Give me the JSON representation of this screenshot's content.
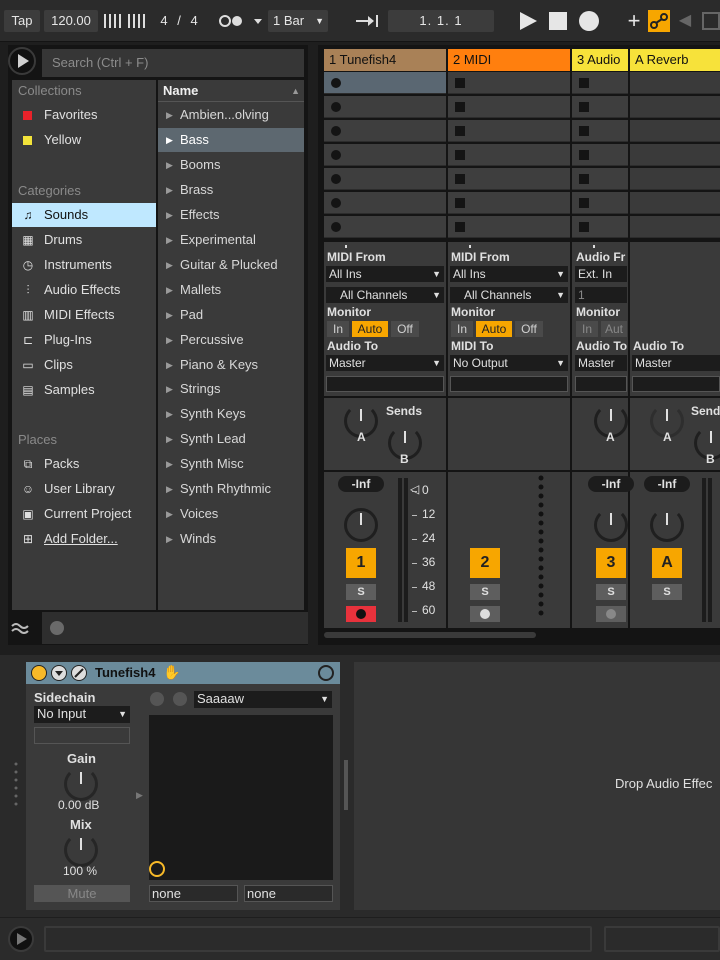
{
  "transport": {
    "tap": "Tap",
    "tempo": "120.00",
    "signature_num": "4",
    "signature_sep": "/",
    "signature_den": "4",
    "quantize": "1 Bar",
    "position": "1.   1.   1"
  },
  "browser": {
    "search_placeholder": "Search (Ctrl + F)",
    "collections_title": "Collections",
    "collections": [
      {
        "label": "Favorites",
        "color": "#e8222a"
      },
      {
        "label": "Yellow",
        "color": "#f2e33a"
      }
    ],
    "categories_title": "Categories",
    "categories": [
      {
        "label": "Sounds",
        "icon": "note-icon"
      },
      {
        "label": "Drums",
        "icon": "grid-icon"
      },
      {
        "label": "Instruments",
        "icon": "clock-icon"
      },
      {
        "label": "Audio Effects",
        "icon": "wave-icon"
      },
      {
        "label": "MIDI Effects",
        "icon": "midi-icon"
      },
      {
        "label": "Plug-Ins",
        "icon": "plug-icon"
      },
      {
        "label": "Clips",
        "icon": "clip-icon"
      },
      {
        "label": "Samples",
        "icon": "sample-icon"
      }
    ],
    "places_title": "Places",
    "places": [
      {
        "label": "Packs",
        "icon": "packs-icon"
      },
      {
        "label": "User Library",
        "icon": "user-icon"
      },
      {
        "label": "Current Project",
        "icon": "project-icon"
      },
      {
        "label": "Add Folder...",
        "icon": "add-folder-icon"
      }
    ],
    "name_header": "Name",
    "items": [
      "Ambien...olving",
      "Bass",
      "Booms",
      "Brass",
      "Effects",
      "Experimental",
      "Guitar & Plucked",
      "Mallets",
      "Pad",
      "Percussive",
      "Piano & Keys",
      "Strings",
      "Synth Keys",
      "Synth Lead",
      "Synth Misc",
      "Synth Rhythmic",
      "Voices",
      "Winds"
    ],
    "selected_item": "Bass"
  },
  "tracks": [
    {
      "name": "1 Tunefish4",
      "color": "#a98157",
      "in_label": "MIDI From",
      "in_value": "All Ins",
      "channel": "All Channels",
      "monitor_label": "Monitor",
      "mon_in": "In",
      "mon_auto": "Auto",
      "mon_off": "Off",
      "out_label": "Audio To",
      "out_value": "Master",
      "sends_label": "Sends",
      "send_a": "A",
      "send_b": "B",
      "volume": "-Inf",
      "number": "1",
      "solo": "S"
    },
    {
      "name": "2 MIDI",
      "color": "#ff7f0e",
      "in_label": "MIDI From",
      "in_value": "All Ins",
      "channel": "All Channels",
      "monitor_label": "Monitor",
      "mon_in": "In",
      "mon_auto": "Auto",
      "mon_off": "Off",
      "out_label": "MIDI To",
      "out_value": "No Output",
      "number": "2",
      "solo": "S"
    },
    {
      "name": "3 Audio",
      "color": "#f7e23a",
      "in_label": "Audio Fr",
      "in_value": "Ext. In",
      "channel": "1",
      "monitor_label": "Monitor",
      "mon_in": "In",
      "mon_auto": "Aut",
      "out_label": "Audio To",
      "out_value": "Master",
      "send_a": "A",
      "volume": "-Inf",
      "number": "3",
      "solo": "S"
    },
    {
      "name": "A Reverb",
      "color": "#f7e23a",
      "out_label": "Audio To",
      "out_value": "Master",
      "sends_label": "Send",
      "send_a": "A",
      "send_b": "B",
      "volume": "-Inf",
      "number": "A",
      "solo": "S"
    }
  ],
  "db_scale": [
    "0",
    "12",
    "24",
    "36",
    "48",
    "60"
  ],
  "device": {
    "title": "Tunefish4",
    "sidechain_label": "Sidechain",
    "sidechain_value": "No Input",
    "gain_label": "Gain",
    "gain_value": "0.00 dB",
    "mix_label": "Mix",
    "mix_value": "100 %",
    "mute_label": "Mute",
    "preset": "Saaaaw",
    "param_a": "none",
    "param_b": "none"
  },
  "drop_zone_text": "Drop Audio Effec"
}
